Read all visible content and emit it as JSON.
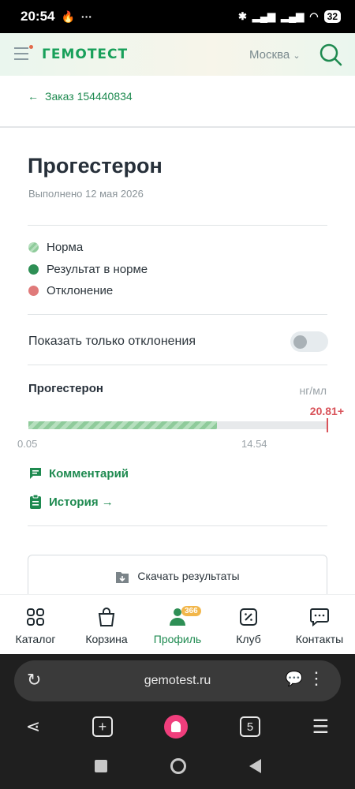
{
  "status_bar": {
    "time": "20:54",
    "battery": "32"
  },
  "header": {
    "logo": "ГЕМОТЕСТ",
    "city": "Москва"
  },
  "order": {
    "back_label": "Заказ 154440834"
  },
  "test": {
    "title": "Прогестерон",
    "completed": "Выполнено 12 мая 2026"
  },
  "legend": [
    {
      "label": "Норма",
      "color": "#8fcb9b"
    },
    {
      "label": "Результат в норме",
      "color": "#2e8f55"
    },
    {
      "label": "Отклонение",
      "color": "#e07a7a"
    }
  ],
  "filter": {
    "label": "Показать только отклонения",
    "enabled": false
  },
  "result": {
    "name": "Прогестерон",
    "unit": "нг/мл",
    "value": "20.81+",
    "range_min": "0.05",
    "range_max": "14.54",
    "status": "deviation",
    "colors": {
      "norm_bar": "#8fcb9b",
      "deviation": "#d9535a"
    }
  },
  "links": {
    "comment": "Комментарий",
    "history": "История →"
  },
  "download": {
    "label": "Скачать результаты"
  },
  "bottom_nav": [
    {
      "label": "Каталог",
      "icon": "grid-icon"
    },
    {
      "label": "Корзина",
      "icon": "bag-icon"
    },
    {
      "label": "Профиль",
      "icon": "profile-icon",
      "badge": "366",
      "active": true
    },
    {
      "label": "Клуб",
      "icon": "percent-icon"
    },
    {
      "label": "Контакты",
      "icon": "chat-icon"
    }
  ],
  "browser": {
    "url": "gemotest.ru",
    "tabs_count": "5"
  }
}
